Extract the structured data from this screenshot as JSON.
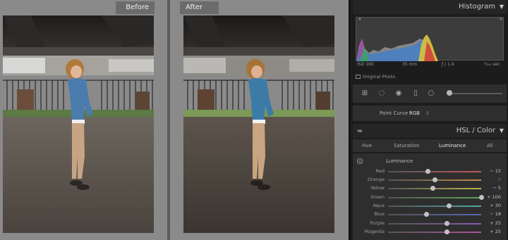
{
  "viewer": {
    "before_label": "Before",
    "after_label": "After"
  },
  "histogram": {
    "title": "Histogram",
    "iso": "ISO 160",
    "focal": "35 mm",
    "aperture": "ƒ / 1.4",
    "shutter": "¹⁄₁₀₀ sec",
    "original_photo_label": "Original Photo"
  },
  "point_curve": {
    "label": "Point Curve :",
    "value": "RGB",
    "chevron": "⇕"
  },
  "hsl": {
    "title": "HSL / Color",
    "tabs": [
      {
        "label": "Hue"
      },
      {
        "label": "Saturation"
      },
      {
        "label": "Luminance"
      },
      {
        "label": "All"
      }
    ],
    "active_tab": "Luminance",
    "section_label": "Luminance",
    "rows": [
      {
        "name": "Red",
        "display": "− 15",
        "value": -15,
        "track": "#c25a5a"
      },
      {
        "name": "Orange",
        "display": "0",
        "value": 0,
        "track": "#c4884e"
      },
      {
        "name": "Yellow",
        "display": "− 5",
        "value": -5,
        "track": "#bdb34c"
      },
      {
        "name": "Green",
        "display": "+ 100",
        "value": 100,
        "track": "#5ca653"
      },
      {
        "name": "Aqua",
        "display": "+ 30",
        "value": 30,
        "track": "#54a7a6"
      },
      {
        "name": "Blue",
        "display": "− 18",
        "value": -18,
        "track": "#5667b5"
      },
      {
        "name": "Purple",
        "display": "+ 25",
        "value": 25,
        "track": "#8a5ab1"
      },
      {
        "name": "Magenta",
        "display": "+ 25",
        "value": 25,
        "track": "#b1519a"
      }
    ]
  },
  "colors": {
    "accent_text": "#c9c9c9",
    "panel_bg": "#2e2e2e"
  },
  "icons": [
    "crop-overlay-icon",
    "spot-removal-icon",
    "red-eye-icon",
    "graduated-filter-icon",
    "radial-filter-icon",
    "adjustment-brush-icon",
    "targeted-adjustment-icon",
    "collapse-triangle-icon"
  ]
}
